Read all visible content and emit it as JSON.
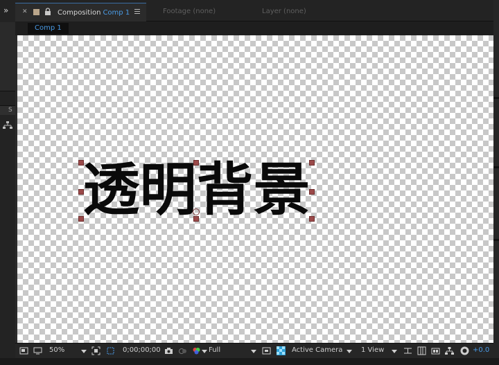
{
  "tabs": {
    "active_prefix": "Composition",
    "active_comp": "Comp 1",
    "footage": "Footage (none)",
    "layer": "Layer (none)"
  },
  "left_panel": {
    "label": "S"
  },
  "subbar": {
    "comp_chip": "Comp 1"
  },
  "canvas": {
    "text": "透明背景"
  },
  "toolbar": {
    "zoom": "50%",
    "timecode": "0;00;00;00",
    "resolution": "Full",
    "camera": "Active Camera",
    "views": "1 View",
    "exposure": "+0.0"
  },
  "colors": {
    "accent": "#4a9be6",
    "handle": "#9b4a4a",
    "label_swatch": "#b9a58a"
  },
  "icons": [
    "expand-chevrons-icon",
    "close-icon",
    "lock-icon",
    "panel-menu-icon",
    "flowchart-icon",
    "snapshot-icon",
    "show-channel-icon",
    "region-of-interest-icon",
    "transparency-grid-icon",
    "grid-guides-icon",
    "monitor-icon"
  ]
}
